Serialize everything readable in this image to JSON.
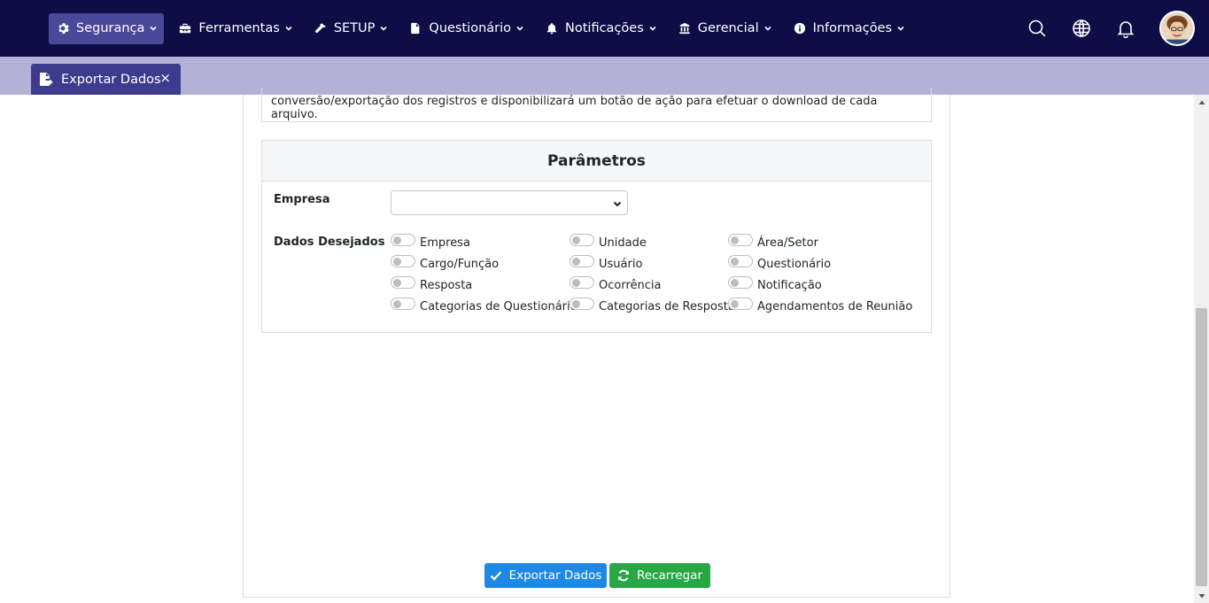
{
  "navbar": {
    "items": [
      {
        "label": "Segurança",
        "icon": "gear-icon",
        "active": true
      },
      {
        "label": "Ferramentas",
        "icon": "toolbox-icon"
      },
      {
        "label": "SETUP",
        "icon": "hammer-icon"
      },
      {
        "label": "Questionário",
        "icon": "file-icon"
      },
      {
        "label": "Notificações",
        "icon": "bell-icon"
      },
      {
        "label": "Gerencial",
        "icon": "building-icon"
      },
      {
        "label": "Informações",
        "icon": "info-circle-icon"
      }
    ],
    "right_icons": [
      "search-icon",
      "globe-icon",
      "bell-outline-icon",
      "user-avatar"
    ]
  },
  "tabs": [
    {
      "label": "Exportar Dados",
      "icon": "file-export-icon",
      "close": "×"
    }
  ],
  "info": {
    "text": "conversão/exportação dos registros e disponibilizará um botão de ação para efetuar o download de cada arquivo."
  },
  "params": {
    "title": "Parâmetros",
    "empresa_label": "Empresa",
    "empresa_value": "",
    "dados_label": "Dados Desejados",
    "options": [
      "Empresa",
      "Unidade",
      "Área/Setor",
      "Cargo/Função",
      "Usuário",
      "Questionário",
      "Resposta",
      "Ocorrência",
      "Notificação",
      "Categorias de Questionários",
      "Categorias de Respostas",
      "Agendamentos de Reunião"
    ]
  },
  "buttons": {
    "export_label": "Exportar Dados",
    "reload_label": "Recarregar"
  },
  "colors": {
    "navbar_bg": "#0f0d46",
    "nav_active_bg": "#4a4899",
    "tabstrip_bg": "#b3b2d6",
    "tab_bg": "#3d3b8e",
    "primary": "#1e88e5",
    "success": "#28a745"
  }
}
